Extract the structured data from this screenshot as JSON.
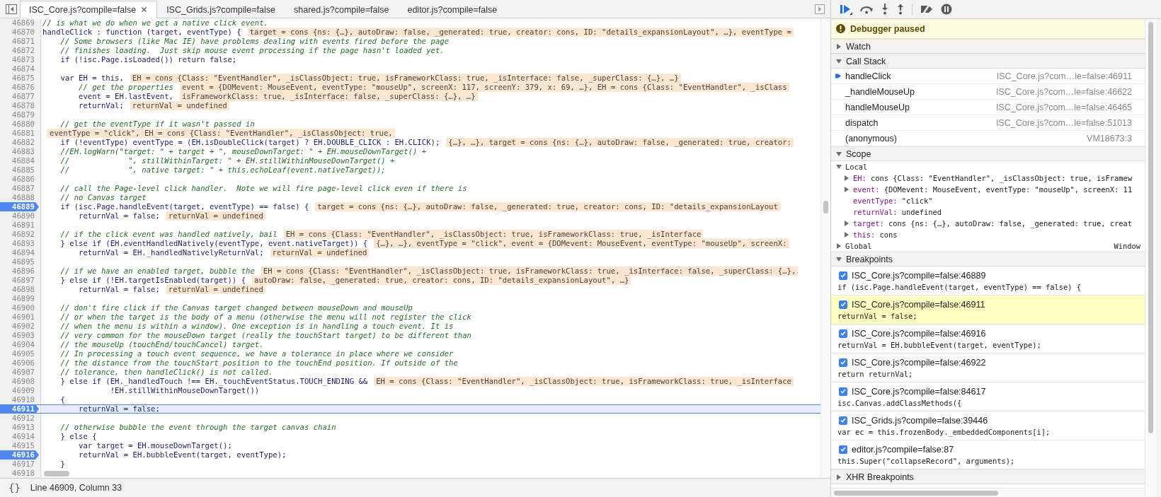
{
  "tabs": [
    {
      "label": "ISC_Core.js?compile=false",
      "selected": true
    },
    {
      "label": "ISC_Grids.js?compile=false",
      "selected": false
    },
    {
      "label": "shared.js?compile=false",
      "selected": false
    },
    {
      "label": "editor.js?compile=false",
      "selected": false
    }
  ],
  "editor": {
    "lines": [
      {
        "number": "46869",
        "kind": "comment",
        "code": "// is what we do when we get a native click event.",
        "breakpoint": false,
        "current": false
      },
      {
        "number": "46870",
        "kind": "code",
        "code": "handleClick : function (target, eventType) {",
        "value": "target = cons {ns: {…}, autoDraw: false, _generated: true, creator: cons, ID: \"details_expansionLayout\", …}, eventType =",
        "breakpoint": false,
        "current": false
      },
      {
        "number": "46871",
        "kind": "comment",
        "code": "    // Some browsers (like Mac IE) have problems dealing with events fired before the page",
        "breakpoint": false,
        "current": false
      },
      {
        "number": "46872",
        "kind": "comment",
        "code": "    // finishes loading.  Just skip mouse event processing if the page hasn't loaded yet.",
        "breakpoint": false,
        "current": false
      },
      {
        "number": "46873",
        "kind": "code",
        "code": "    if (!isc.Page.isLoaded()) return false;",
        "breakpoint": false,
        "current": false
      },
      {
        "number": "46874",
        "breakpoint": false,
        "current": false
      },
      {
        "number": "46875",
        "kind": "code",
        "code": "    var EH = this,",
        "value": "EH = cons {Class: \"EventHandler\", _isClassObject: true, isFrameworkClass: true, _isInterface: false, _superClass: {…}, …}",
        "breakpoint": false,
        "current": false
      },
      {
        "number": "46876",
        "kind": "comment",
        "code": "        // get the properties",
        "value": "event = {DOMevent: MouseEvent, eventType: \"mouseUp\", screenX: 117, screenY: 379, x: 69, …}, EH = cons {Class: \"EventHandler\", _isClass",
        "breakpoint": false,
        "current": false
      },
      {
        "number": "46877",
        "kind": "code",
        "code": "        event = EH.lastEvent,",
        "value": "isFrameworkClass: true, _isInterface: false, _superClass: {…}, …}",
        "breakpoint": false,
        "current": false
      },
      {
        "number": "46878",
        "kind": "code",
        "code": "        returnVal;",
        "value": "returnVal = undefined",
        "breakpoint": false,
        "current": false
      },
      {
        "number": "46879",
        "breakpoint": false,
        "current": false
      },
      {
        "number": "46880",
        "kind": "comment",
        "code": "    // get the eventType if it wasn't passed in",
        "breakpoint": false,
        "current": false
      },
      {
        "number": "46881",
        "value": "eventType = \"click\", EH = cons {Class: \"EventHandler\", _isClassObject: true,",
        "breakpoint": false,
        "current": false
      },
      {
        "number": "46882",
        "kind": "code",
        "code": "    if (!eventType) eventType = (EH.isDoubleClick(target) ? EH.DOUBLE_CLICK : EH.CLICK);",
        "value": "{…}, …}, target = cons {ns: {…}, autoDraw: false, _generated: true, creator:",
        "breakpoint": false,
        "current": false
      },
      {
        "number": "46883",
        "kind": "comment",
        "code": "    //EH.logWarn(\"target: \" + target + \", mouseDownTarget: \" + EH.mouseDownTarget() +",
        "breakpoint": false,
        "current": false
      },
      {
        "number": "46884",
        "kind": "comment",
        "code": "    //             \", stillWithinTarget: \" + EH.stillWithinMouseDownTarget() +",
        "breakpoint": false,
        "current": false
      },
      {
        "number": "46885",
        "kind": "comment",
        "code": "    //             \", native target: \" + this.echoLeaf(event.nativeTarget));",
        "breakpoint": false,
        "current": false
      },
      {
        "number": "46886",
        "breakpoint": false,
        "current": false
      },
      {
        "number": "46887",
        "kind": "comment",
        "code": "    // call the Page-level click handler.  Note we will fire page-level click even if there is",
        "breakpoint": false,
        "current": false
      },
      {
        "number": "46888",
        "kind": "comment",
        "code": "    // no Canvas target",
        "breakpoint": false,
        "current": false
      },
      {
        "number": "46889",
        "kind": "code",
        "code": "    if (isc.Page.handleEvent(target, eventType) == false) {",
        "value": "target = cons {ns: {…}, autoDraw: false, _generated: true, creator: cons, ID: \"details_expansionLayout",
        "breakpoint": true,
        "current": false
      },
      {
        "number": "46890",
        "kind": "code",
        "code": "        returnVal = false;",
        "value": "returnVal = undefined",
        "breakpoint": false,
        "current": false
      },
      {
        "number": "46891",
        "breakpoint": false,
        "current": false
      },
      {
        "number": "46892",
        "kind": "comment",
        "code": "    // if the click event was handled natively, bail",
        "value": "EH = cons {Class: \"EventHandler\", _isClassObject: true, isFrameworkClass: true, _isInterface",
        "breakpoint": false,
        "current": false
      },
      {
        "number": "46893",
        "kind": "code",
        "code": "    } else if (EH.eventHandledNatively(eventType, event.nativeTarget)) {",
        "value": "{…}, …}, eventType = \"click\", event = {DOMevent: MouseEvent, eventType: \"mouseUp\", screenX:",
        "breakpoint": false,
        "current": false
      },
      {
        "number": "46894",
        "kind": "code",
        "code": "        returnVal = EH._handledNativelyReturnVal;",
        "value": "returnVal = undefined",
        "breakpoint": false,
        "current": false
      },
      {
        "number": "46895",
        "breakpoint": false,
        "current": false
      },
      {
        "number": "46896",
        "kind": "comment",
        "code": "    // if we have an enabled target, bubble the",
        "value": "EH = cons {Class: \"EventHandler\", _isClassObject: true, isFrameworkClass: true, _isInterface: false, _superClass: {…},",
        "breakpoint": false,
        "current": false
      },
      {
        "number": "46897",
        "kind": "code",
        "code": "    } else if (!EH.targetIsEnabled(target)) {",
        "value": "autoDraw: false, _generated: true, creator: cons, ID: \"details_expansionLayout\", …}",
        "breakpoint": false,
        "current": false
      },
      {
        "number": "46898",
        "kind": "code",
        "code": "        returnVal = false;",
        "value": "returnVal = undefined",
        "breakpoint": false,
        "current": false
      },
      {
        "number": "46899",
        "breakpoint": false,
        "current": false
      },
      {
        "number": "46900",
        "kind": "comment",
        "code": "    // don't fire click if the Canvas target changed between mouseDown and mouseUp",
        "breakpoint": false,
        "current": false
      },
      {
        "number": "46901",
        "kind": "comment",
        "code": "    // or when the target is the body of a menu (otherwise the menu will not register the click",
        "breakpoint": false,
        "current": false
      },
      {
        "number": "46902",
        "kind": "comment",
        "code": "    // when the menu is within a window). One exception is in handling a touch event. It is",
        "breakpoint": false,
        "current": false
      },
      {
        "number": "46903",
        "kind": "comment",
        "code": "    // very common for the mouseDown target (really the touchStart target) to be different than",
        "breakpoint": false,
        "current": false
      },
      {
        "number": "46904",
        "kind": "comment",
        "code": "    // the mouseUp (touchEnd/touchCancel) target.",
        "breakpoint": false,
        "current": false
      },
      {
        "number": "46905",
        "kind": "comment",
        "code": "    // In processing a touch event sequence, we have a tolerance in place where we consider",
        "breakpoint": false,
        "current": false
      },
      {
        "number": "46906",
        "kind": "comment",
        "code": "    // the distance from the touchStart position to the touchEnd position. If outside of the",
        "breakpoint": false,
        "current": false
      },
      {
        "number": "46907",
        "kind": "comment",
        "code": "    // tolerance, then handleClick() is not called.",
        "breakpoint": false,
        "current": false
      },
      {
        "number": "46908",
        "kind": "code",
        "code": "    } else if (EH._handledTouch !== EH._touchEventStatus.TOUCH_ENDING &&",
        "value": "EH = cons {Class: \"EventHandler\", _isClassObject: true, isFrameworkClass: true, _isInterface",
        "breakpoint": false,
        "current": false
      },
      {
        "number": "46909",
        "kind": "code",
        "code": "               !EH.stillWithinMouseDownTarget())",
        "breakpoint": false,
        "current": false
      },
      {
        "number": "46910",
        "kind": "code",
        "code": "    {",
        "breakpoint": false,
        "current": false
      },
      {
        "number": "46911",
        "kind": "code",
        "code": "        returnVal = false;",
        "breakpoint": true,
        "current": true
      },
      {
        "number": "46912",
        "breakpoint": false,
        "current": false
      },
      {
        "number": "46913",
        "kind": "comment",
        "code": "    // otherwise bubble the event through the target canvas chain",
        "breakpoint": false,
        "current": false
      },
      {
        "number": "46914",
        "kind": "code",
        "code": "    } else {",
        "breakpoint": false,
        "current": false
      },
      {
        "number": "46915",
        "kind": "code",
        "code": "        var target = EH.mouseDownTarget();",
        "breakpoint": false,
        "current": false
      },
      {
        "number": "46916",
        "kind": "code",
        "code": "        returnVal = EH.bubbleEvent(target, eventType);",
        "breakpoint": true,
        "current": false
      },
      {
        "number": "46917",
        "kind": "code",
        "code": "    }",
        "breakpoint": false,
        "current": false
      },
      {
        "number": "46918",
        "breakpoint": false,
        "current": false
      }
    ]
  },
  "status_bar": {
    "format_button": "{}",
    "position": "Line 46909, Column 33"
  },
  "debugger": {
    "paused_message": "Debugger paused",
    "sections": [
      {
        "title": "Watch",
        "expanded": false
      },
      {
        "kind": "call_stack",
        "title": "Call Stack",
        "expanded": true,
        "frames": [
          {
            "name": "handleClick",
            "location": "ISC_Core.js?com…le=false:46911",
            "selected": true
          },
          {
            "name": "_handleMouseUp",
            "location": "ISC_Core.js?com…le=false:46622",
            "selected": false
          },
          {
            "name": "handleMouseUp",
            "location": "ISC_Core.js?com…le=false:46465",
            "selected": false
          },
          {
            "name": "dispatch",
            "location": "ISC_Core.js?com…le=false:51013",
            "selected": false
          },
          {
            "name": "(anonymous)",
            "location": "VM18673:3",
            "selected": false
          }
        ]
      },
      {
        "kind": "scope",
        "title": "Scope",
        "expanded": true,
        "scopes": [
          {
            "name": "Local",
            "expanded": true,
            "properties": [
              {
                "name": "EH:",
                "value": "cons {Class: \"EventHandler\", _isClassObject: true, isFramew",
                "expandable": true
              },
              {
                "name": "event:",
                "value": "{DOMevent: MouseEvent, eventType: \"mouseUp\", screenX: 11",
                "expandable": true
              },
              {
                "name": "eventType:",
                "value": "\"click\"",
                "expandable": false
              },
              {
                "name": "returnVal:",
                "value": "undefined",
                "expandable": false
              },
              {
                "name": "target:",
                "value": "cons {ns: {…}, autoDraw: false, _generated: true, creat",
                "expandable": true
              },
              {
                "name": "this:",
                "value": "cons",
                "expandable": true
              }
            ]
          },
          {
            "name": "Global",
            "expanded": false,
            "value": "Window"
          }
        ]
      },
      {
        "kind": "breakpoints",
        "title": "Breakpoints",
        "expanded": true,
        "items": [
          {
            "location": "ISC_Core.js?compile=false:46889",
            "code": "if (isc.Page.handleEvent(target, eventType) == false) {",
            "checked": true,
            "selected": false
          },
          {
            "location": "ISC_Core.js?compile=false:46911",
            "code": "returnVal = false;",
            "checked": true,
            "selected": true
          },
          {
            "location": "ISC_Core.js?compile=false:46916",
            "code": "returnVal = EH.bubbleEvent(target, eventType);",
            "checked": true,
            "selected": false
          },
          {
            "location": "ISC_Core.js?compile=false:46922",
            "code": "return returnVal;",
            "checked": true,
            "selected": false
          },
          {
            "location": "ISC_Core.js?compile=false:84617",
            "code": "isc.Canvas.addClassMethods({",
            "checked": true,
            "selected": false
          },
          {
            "location": "ISC_Grids.js?compile=false:39446",
            "code": "var ec = this.frozenBody._embeddedComponents[i];",
            "checked": true,
            "selected": false
          },
          {
            "location": "editor.js?compile=false:87",
            "code": "this.Super(\"collapseRecord\", arguments);",
            "checked": true,
            "selected": false
          }
        ]
      },
      {
        "title": "XHR Breakpoints",
        "expanded": false
      }
    ]
  }
}
